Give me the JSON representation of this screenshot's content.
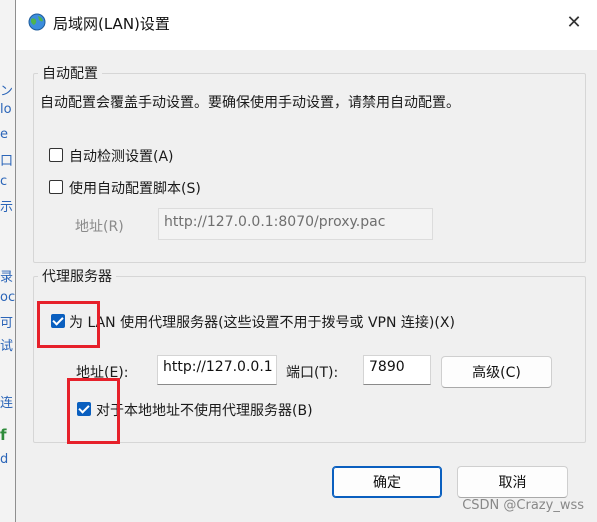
{
  "window": {
    "title": "局域网(LAN)设置",
    "close_glyph": "✕"
  },
  "background_window": {
    "glyphs": [
      "ン",
      "lo",
      "e",
      "口",
      "c",
      "示",
      "录",
      "oc",
      "可",
      "试",
      "连",
      "f",
      "d"
    ]
  },
  "auto_config": {
    "group_label": "自动配置",
    "description": "自动配置会覆盖手动设置。要确保使用手动设置，请禁用自动配置。",
    "auto_detect": {
      "label": "自动检测设置(A)",
      "checked": false
    },
    "use_script": {
      "label": "使用自动配置脚本(S)",
      "checked": false
    },
    "address_label": "地址(R)",
    "address_value": "http://127.0.0.1:8070/proxy.pac"
  },
  "proxy": {
    "group_label": "代理服务器",
    "use_proxy": {
      "label": "为 LAN 使用代理服务器(这些设置不用于拨号或 VPN 连接)(X)",
      "checked": true
    },
    "address_label": "地址(E):",
    "address_value": "http://127.0.0.1",
    "port_label": "端口(T):",
    "port_value": "7890",
    "advanced_label": "高级(C)",
    "bypass_local": {
      "label": "对于本地地址不使用代理服务器(B)",
      "checked": true
    }
  },
  "buttons": {
    "ok": "确定",
    "cancel": "取消"
  },
  "watermark": "CSDN @Crazy_wss",
  "colors": {
    "accent": "#0a5fbf",
    "highlight_box": "#e6202a"
  }
}
